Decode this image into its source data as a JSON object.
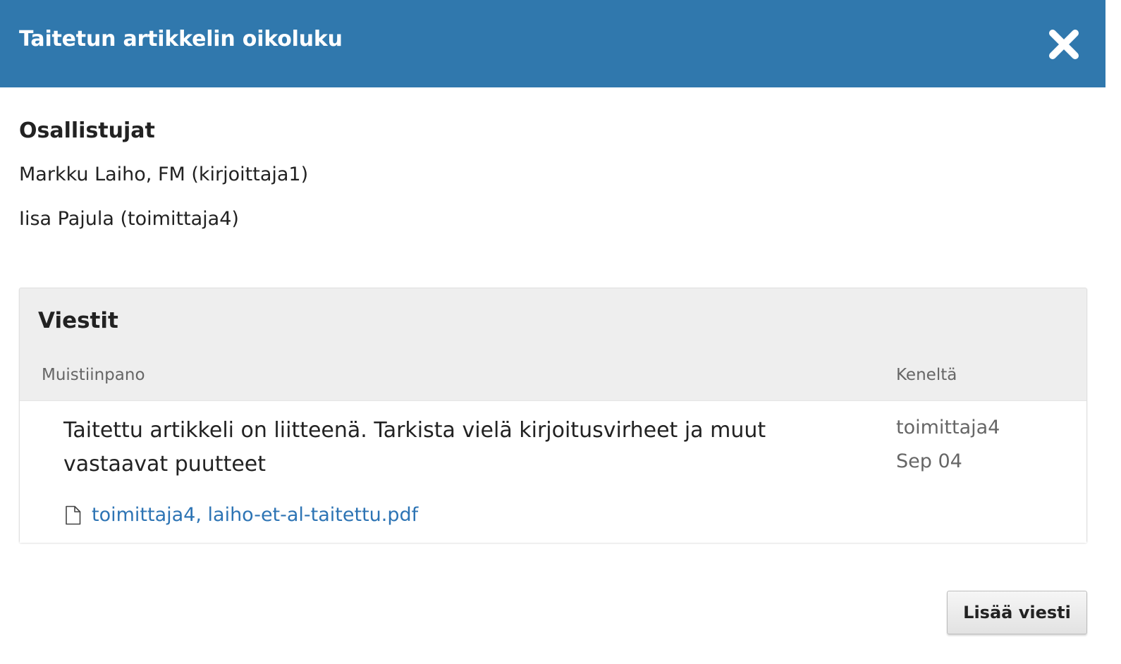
{
  "modal": {
    "title": "Taitetun artikkelin oikoluku",
    "close_icon": "close-icon",
    "header_color": "#3078ad"
  },
  "participants": {
    "heading": "Osallistujat",
    "items": [
      "Markku Laiho, FM (kirjoittaja1)",
      "Iisa Pajula (toimittaja4)"
    ]
  },
  "messages": {
    "heading": "Viestit",
    "columns": {
      "note": "Muistiinpano",
      "from": "Keneltä"
    },
    "items": [
      {
        "text": "Taitettu artikkeli on liitteenä. Tarkista vielä kirjoitusvirheet ja muut vastaavat puutteet",
        "author": "toimittaja4",
        "date": "Sep 04",
        "attachment": {
          "icon": "file-icon",
          "label": "toimittaja4, laiho-et-al-taitettu.pdf"
        }
      }
    ]
  },
  "actions": {
    "add_message_label": "Lisää viesti"
  },
  "colors": {
    "link": "#2d74b4",
    "panel_background": "#eeeeee"
  }
}
